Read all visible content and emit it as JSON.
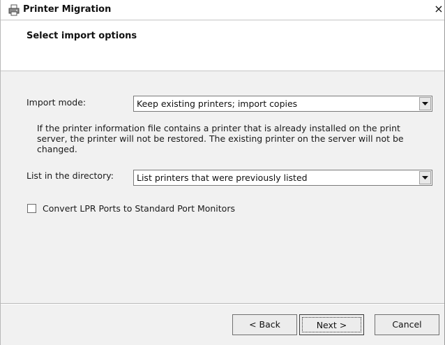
{
  "window": {
    "title": "Printer Migration",
    "icon": "printer-icon",
    "close_glyph": "×"
  },
  "header": {
    "title": "Select import options"
  },
  "form": {
    "import_mode": {
      "label": "Import mode:",
      "value": "Keep existing printers; import copies"
    },
    "info_text": "If the printer information file contains a printer that is already installed on the print server, the printer will not be restored. The existing printer on the server will not be changed.",
    "directory": {
      "label": "List in the directory:",
      "value": "List printers that were previously listed"
    },
    "convert_lpr": {
      "label": "Convert LPR Ports to Standard Port Monitors",
      "checked": false
    }
  },
  "footer": {
    "back_label": "< Back",
    "next_label": "Next >",
    "cancel_label": "Cancel"
  }
}
